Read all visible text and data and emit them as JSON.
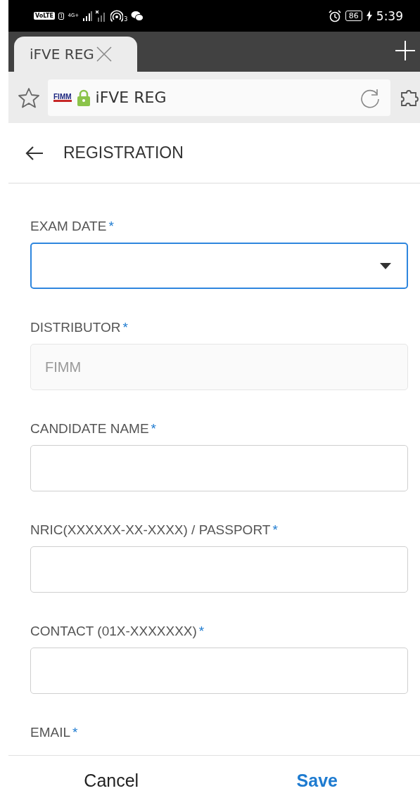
{
  "status_bar": {
    "volte": "VoLTE",
    "sim": "1",
    "network": "4G+",
    "hotspot_count": "3",
    "battery": "86",
    "time": "5:39"
  },
  "browser": {
    "tab": {
      "title": "iFVE REG",
      "selected": true
    },
    "address": {
      "logo": "FIMM",
      "title": "iFVE REG",
      "secure": true
    }
  },
  "header": {
    "title": "REGISTRATION"
  },
  "fields": [
    {
      "label": "EXAM DATE",
      "required_mark": "*",
      "kind": "select",
      "focused": true,
      "disabled": false
    },
    {
      "label": "DISTRIBUTOR",
      "required_mark": "*",
      "kind": "text",
      "focused": false,
      "disabled": true,
      "value": "FIMM"
    },
    {
      "label": "CANDIDATE NAME",
      "required_mark": "*",
      "kind": "text",
      "focused": false,
      "disabled": false
    },
    {
      "label": "NRIC(XXXXXX-XX-XXXX) / PASSPORT",
      "required_mark": "*",
      "kind": "text",
      "focused": false,
      "disabled": false
    },
    {
      "label": "CONTACT (01X-XXXXXXX)",
      "required_mark": "*",
      "kind": "text",
      "focused": false,
      "disabled": false
    },
    {
      "label": "EMAIL",
      "required_mark": "*",
      "kind": "label_only"
    }
  ],
  "actions": [
    {
      "label": "Cancel",
      "kind": "secondary"
    },
    {
      "label": "Save",
      "kind": "primary"
    }
  ]
}
